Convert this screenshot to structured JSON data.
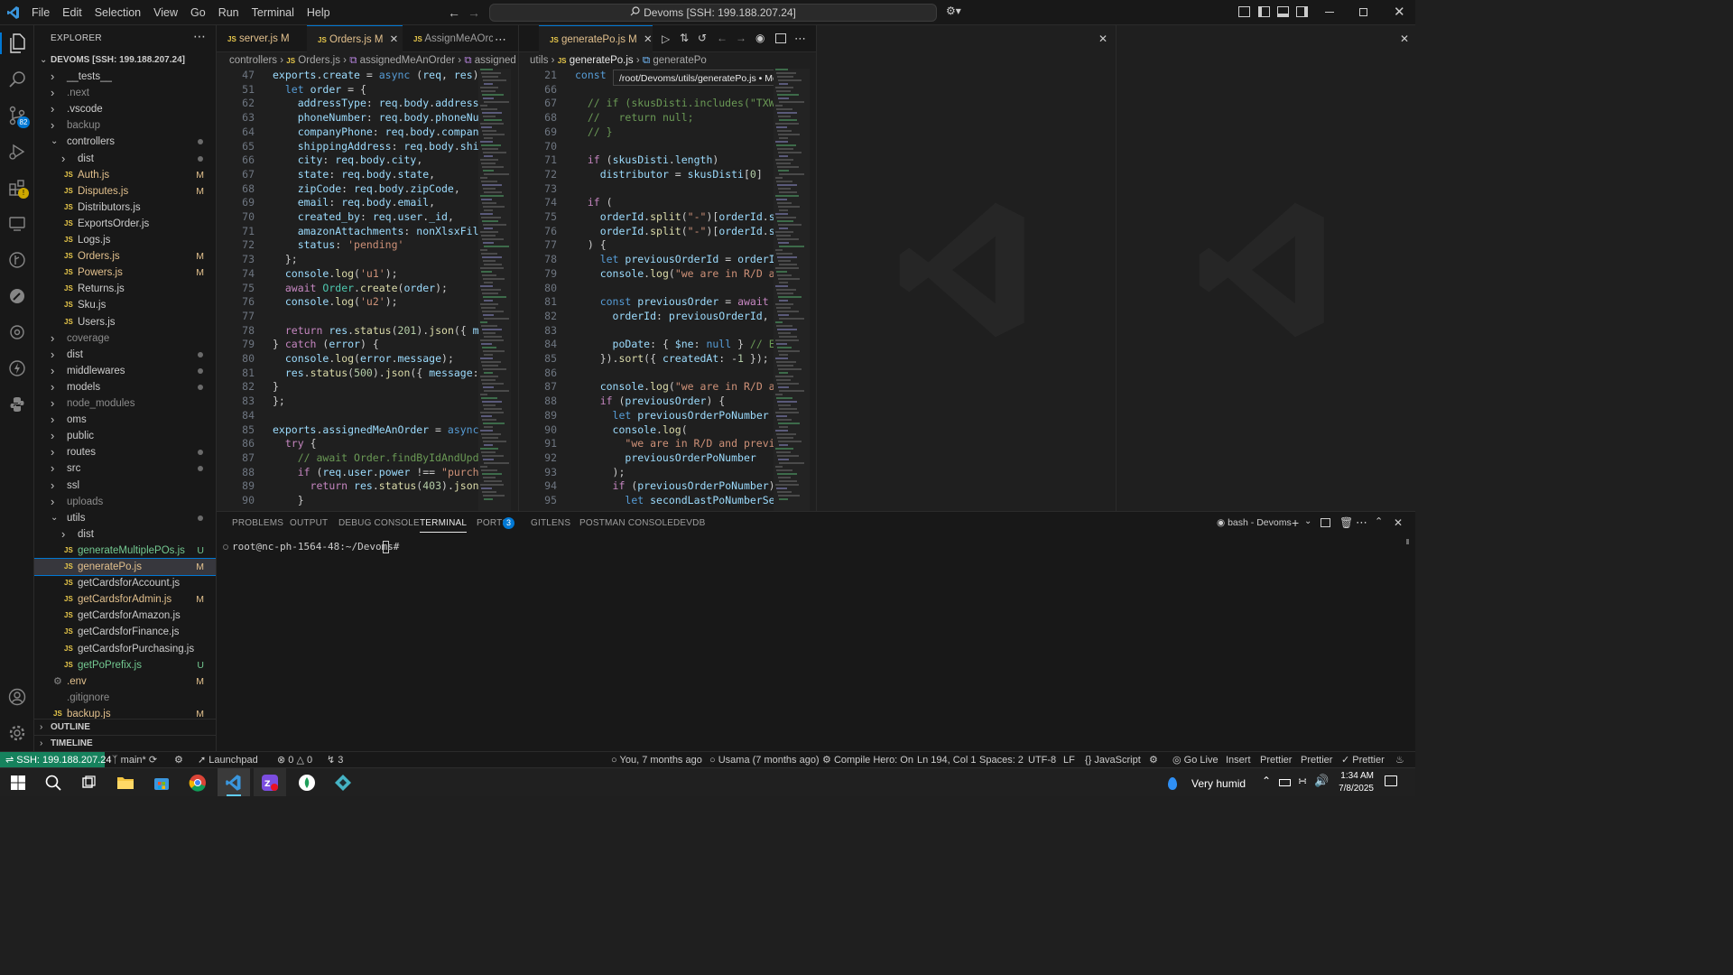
{
  "titlebar": {
    "menu": [
      "File",
      "Edit",
      "Selection",
      "View",
      "Go",
      "Run",
      "Terminal",
      "Help"
    ],
    "command_center": "Devoms [SSH: 199.188.207.24]"
  },
  "explorer": {
    "title": "EXPLORER",
    "root": "DEVOMS [SSH: 199.188.207.24]",
    "items": [
      {
        "label": "__tests__",
        "type": "folder",
        "open": false,
        "indent": 1
      },
      {
        "label": ".next",
        "type": "folder",
        "open": false,
        "indent": 1
      },
      {
        "label": ".vscode",
        "type": "folder",
        "open": false,
        "indent": 1
      },
      {
        "label": "backup",
        "type": "folder",
        "open": false,
        "indent": 1
      },
      {
        "label": "controllers",
        "type": "folder",
        "open": true,
        "indent": 1,
        "dot": true
      },
      {
        "label": "dist",
        "type": "folder",
        "open": false,
        "indent": 2,
        "dot": true
      },
      {
        "label": "Auth.js",
        "type": "file",
        "indent": 2,
        "status": "M"
      },
      {
        "label": "Disputes.js",
        "type": "file",
        "indent": 2,
        "status": "M"
      },
      {
        "label": "Distributors.js",
        "type": "file",
        "indent": 2
      },
      {
        "label": "ExportsOrder.js",
        "type": "file",
        "indent": 2
      },
      {
        "label": "Logs.js",
        "type": "file",
        "indent": 2
      },
      {
        "label": "Orders.js",
        "type": "file",
        "indent": 2,
        "status": "M"
      },
      {
        "label": "Powers.js",
        "type": "file",
        "indent": 2,
        "status": "M"
      },
      {
        "label": "Returns.js",
        "type": "file",
        "indent": 2
      },
      {
        "label": "Sku.js",
        "type": "file",
        "indent": 2
      },
      {
        "label": "Users.js",
        "type": "file",
        "indent": 2
      },
      {
        "label": "coverage",
        "type": "folder",
        "open": false,
        "indent": 1
      },
      {
        "label": "dist",
        "type": "folder",
        "open": false,
        "indent": 1,
        "dot": true
      },
      {
        "label": "middlewares",
        "type": "folder",
        "open": false,
        "indent": 1,
        "dot": true
      },
      {
        "label": "models",
        "type": "folder",
        "open": false,
        "indent": 1,
        "dot": true
      },
      {
        "label": "node_modules",
        "type": "folder",
        "open": false,
        "indent": 1
      },
      {
        "label": "oms",
        "type": "folder",
        "open": false,
        "indent": 1
      },
      {
        "label": "public",
        "type": "folder",
        "open": false,
        "indent": 1
      },
      {
        "label": "routes",
        "type": "folder",
        "open": false,
        "indent": 1,
        "dot": true
      },
      {
        "label": "src",
        "type": "folder",
        "open": false,
        "indent": 1,
        "dot": true
      },
      {
        "label": "ssl",
        "type": "folder",
        "open": false,
        "indent": 1
      },
      {
        "label": "uploads",
        "type": "folder",
        "open": false,
        "indent": 1
      },
      {
        "label": "utils",
        "type": "folder",
        "open": true,
        "indent": 1,
        "dot": true
      },
      {
        "label": "dist",
        "type": "folder",
        "open": false,
        "indent": 2
      },
      {
        "label": "generateMultiplePOs.js",
        "type": "file",
        "indent": 2,
        "status": "U"
      },
      {
        "label": "generatePo.js",
        "type": "file",
        "indent": 2,
        "status": "M",
        "selected": true
      },
      {
        "label": "getCardsforAccount.js",
        "type": "file",
        "indent": 2
      },
      {
        "label": "getCardsforAdmin.js",
        "type": "file",
        "indent": 2,
        "status": "M"
      },
      {
        "label": "getCardsforAmazon.js",
        "type": "file",
        "indent": 2
      },
      {
        "label": "getCardsforFinance.js",
        "type": "file",
        "indent": 2
      },
      {
        "label": "getCardsforPurchasing.js",
        "type": "file",
        "indent": 2
      },
      {
        "label": "getPoPrefix.js",
        "type": "file",
        "indent": 2,
        "status": "U"
      },
      {
        "label": ".env",
        "type": "gear",
        "indent": 1,
        "status": "M"
      },
      {
        "label": ".gitignore",
        "type": "plain",
        "indent": 1
      },
      {
        "label": "backup.js",
        "type": "file",
        "indent": 1,
        "status": "M"
      }
    ],
    "outline": "OUTLINE",
    "timeline": "TIMELINE"
  },
  "editor_left": {
    "tabs": [
      {
        "label": "server.js",
        "status": "M"
      },
      {
        "label": "Orders.js",
        "status": "M",
        "active": true
      },
      {
        "label": "AssignMeAOrc"
      }
    ],
    "breadcrumb": [
      "controllers",
      "Orders.js",
      "assignedMeAnOrder",
      "assigned"
    ],
    "lines": [
      {
        "n": "47",
        "t": "exports.create = async (req, res) ="
      },
      {
        "n": "51",
        "t": "  let order = {"
      },
      {
        "n": "62",
        "t": "    addressType: req.body.address"
      },
      {
        "n": "63",
        "t": "    phoneNumber: req.body.phoneNu"
      },
      {
        "n": "64",
        "t": "    companyPhone: req.body.company"
      },
      {
        "n": "65",
        "t": "    shippingAddress: req.body.shi"
      },
      {
        "n": "66",
        "t": "    city: req.body.city,"
      },
      {
        "n": "67",
        "t": "    state: req.body.state,"
      },
      {
        "n": "68",
        "t": "    zipCode: req.body.zipCode,"
      },
      {
        "n": "69",
        "t": "    email: req.body.email,"
      },
      {
        "n": "70",
        "t": "    created_by: req.user._id,"
      },
      {
        "n": "71",
        "t": "    amazonAttachments: nonXlsxFil"
      },
      {
        "n": "72",
        "t": "    status: 'pending'"
      },
      {
        "n": "73",
        "t": "  };"
      },
      {
        "n": "74",
        "t": "  console.log('u1');"
      },
      {
        "n": "75",
        "t": "  await Order.create(order);"
      },
      {
        "n": "76",
        "t": "  console.log('u2');"
      },
      {
        "n": "77",
        "t": ""
      },
      {
        "n": "78",
        "t": "  return res.status(201).json({ m"
      },
      {
        "n": "79",
        "t": "} catch (error) {"
      },
      {
        "n": "80",
        "t": "  console.log(error.message);"
      },
      {
        "n": "81",
        "t": "  res.status(500).json({ message:"
      },
      {
        "n": "82",
        "t": "}"
      },
      {
        "n": "83",
        "t": "};"
      },
      {
        "n": "84",
        "t": ""
      },
      {
        "n": "85",
        "t": "exports.assignedMeAnOrder = async (r"
      },
      {
        "n": "86",
        "t": "  try {"
      },
      {
        "n": "87",
        "t": "    // await Order.findByIdAndUpdate"
      },
      {
        "n": "88",
        "t": "    if (req.user.power !== \"purchas"
      },
      {
        "n": "89",
        "t": "      return res.status(403).json({"
      },
      {
        "n": "90",
        "t": "    }"
      }
    ]
  },
  "editor_right": {
    "tabs": [
      {
        "label": "generatePo.js",
        "status": "M",
        "active": true
      }
    ],
    "breadcrumb": [
      "utils",
      "generatePo.js",
      "generatePo"
    ],
    "tooltip": "/root/Devoms/utils/generatePo.js • Modified",
    "lines": [
      {
        "n": "21",
        "t": "const ge"
      },
      {
        "n": "66",
        "t": ""
      },
      {
        "n": "67",
        "t": "  // if (skusDisti.includes(\"TXWH\"))"
      },
      {
        "n": "68",
        "t": "  //   return null;"
      },
      {
        "n": "69",
        "t": "  // }"
      },
      {
        "n": "70",
        "t": ""
      },
      {
        "n": "71",
        "t": "  if (skusDisti.length)"
      },
      {
        "n": "72",
        "t": "    distributor = skusDisti[0]"
      },
      {
        "n": "73",
        "t": ""
      },
      {
        "n": "74",
        "t": "  if ("
      },
      {
        "n": "75",
        "t": "    orderId.split(\"-\")[orderId.split"
      },
      {
        "n": "76",
        "t": "    orderId.split(\"-\")[orderId.split"
      },
      {
        "n": "77",
        "t": "  ) {"
      },
      {
        "n": "78",
        "t": "    let previousOrderId = orderId.sp"
      },
      {
        "n": "79",
        "t": "    console.log(\"we are in R/D and p"
      },
      {
        "n": "80",
        "t": ""
      },
      {
        "n": "81",
        "t": "    const previousOrder = await Orde"
      },
      {
        "n": "82",
        "t": "      orderId: previousOrderId, // E"
      },
      {
        "n": "83",
        "t": ""
      },
      {
        "n": "84",
        "t": "      poDate: { $ne: null } // Ensur"
      },
      {
        "n": "85",
        "t": "    }).sort({ createdAt: -1 }); // E"
      },
      {
        "n": "86",
        "t": ""
      },
      {
        "n": "87",
        "t": "    console.log(\"we are in R/D and p"
      },
      {
        "n": "88",
        "t": "    if (previousOrder) {"
      },
      {
        "n": "89",
        "t": "      let previousOrderPoNumber = pr"
      },
      {
        "n": "90",
        "t": "      console.log("
      },
      {
        "n": "91",
        "t": "        \"we are in R/D and previous"
      },
      {
        "n": "92",
        "t": "        previousOrderPoNumber"
      },
      {
        "n": "93",
        "t": "      );"
      },
      {
        "n": "94",
        "t": "      if (previousOrderPoNumber) {"
      },
      {
        "n": "95",
        "t": "        let secondLastPoNumberSectio"
      }
    ]
  },
  "panel": {
    "tabs": [
      "PROBLEMS",
      "OUTPUT",
      "DEBUG CONSOLE",
      "TERMINAL",
      "PORTS",
      "GITLENS",
      "POSTMAN CONSOLE",
      "DEVDB"
    ],
    "active_tab": "TERMINAL",
    "ports_badge": "3",
    "terminal_name": "bash - Devoms",
    "prompt": "root@nc-ph-1564-48:~/Devoms#"
  },
  "statusbar": {
    "remote": "SSH: 199.188.207.24",
    "branch": "main*",
    "launchpad": "Launchpad",
    "errors": "0",
    "warnings": "0",
    "ports": "3",
    "blame": "You, 7 months ago",
    "author": "Usama (7 months ago)",
    "compile_hero": "Compile Hero: On",
    "position": "Ln 194, Col 1",
    "spaces": "Spaces: 2",
    "encoding": "UTF-8",
    "eol": "LF",
    "language": "JavaScript",
    "golive": "Go Live",
    "insert": "Insert",
    "prettier1": "Prettier",
    "prettier2": "Prettier",
    "prettier3": "Prettier"
  },
  "badges": {
    "source_control": "82"
  },
  "taskbar": {
    "weather": "Very humid",
    "time": "1:34 AM",
    "date": "7/8/2025"
  },
  "colors": {
    "accent": "#0078d4",
    "remote_bg": "#16825d",
    "modified": "#e2c08d",
    "untracked": "#73c991"
  }
}
